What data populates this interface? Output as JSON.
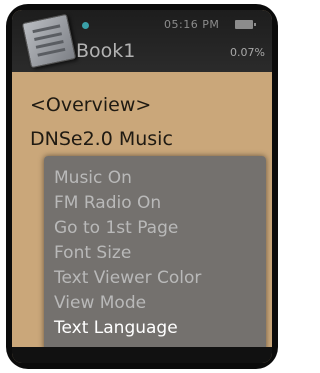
{
  "header": {
    "clock": "05:16 PM",
    "book_title": "Book1",
    "progress": "0.07%",
    "battery_icon": "battery-icon",
    "book_icon": "book-icon"
  },
  "content": {
    "line1": "<Overview>",
    "line2": "DNSe2.0 Music"
  },
  "menu": {
    "items": [
      {
        "label": "Music On"
      },
      {
        "label": "FM Radio On"
      },
      {
        "label": "Go to 1st Page"
      },
      {
        "label": "Font Size"
      },
      {
        "label": "Text Viewer Color"
      },
      {
        "label": "View Mode"
      },
      {
        "label": "Text Language",
        "selected": true
      }
    ]
  },
  "colors": {
    "screen_bg": "#caa77a",
    "menu_bg": "#6c6c6c",
    "menu_text": "#b9b9b9",
    "selected_text": "#ffffff"
  }
}
